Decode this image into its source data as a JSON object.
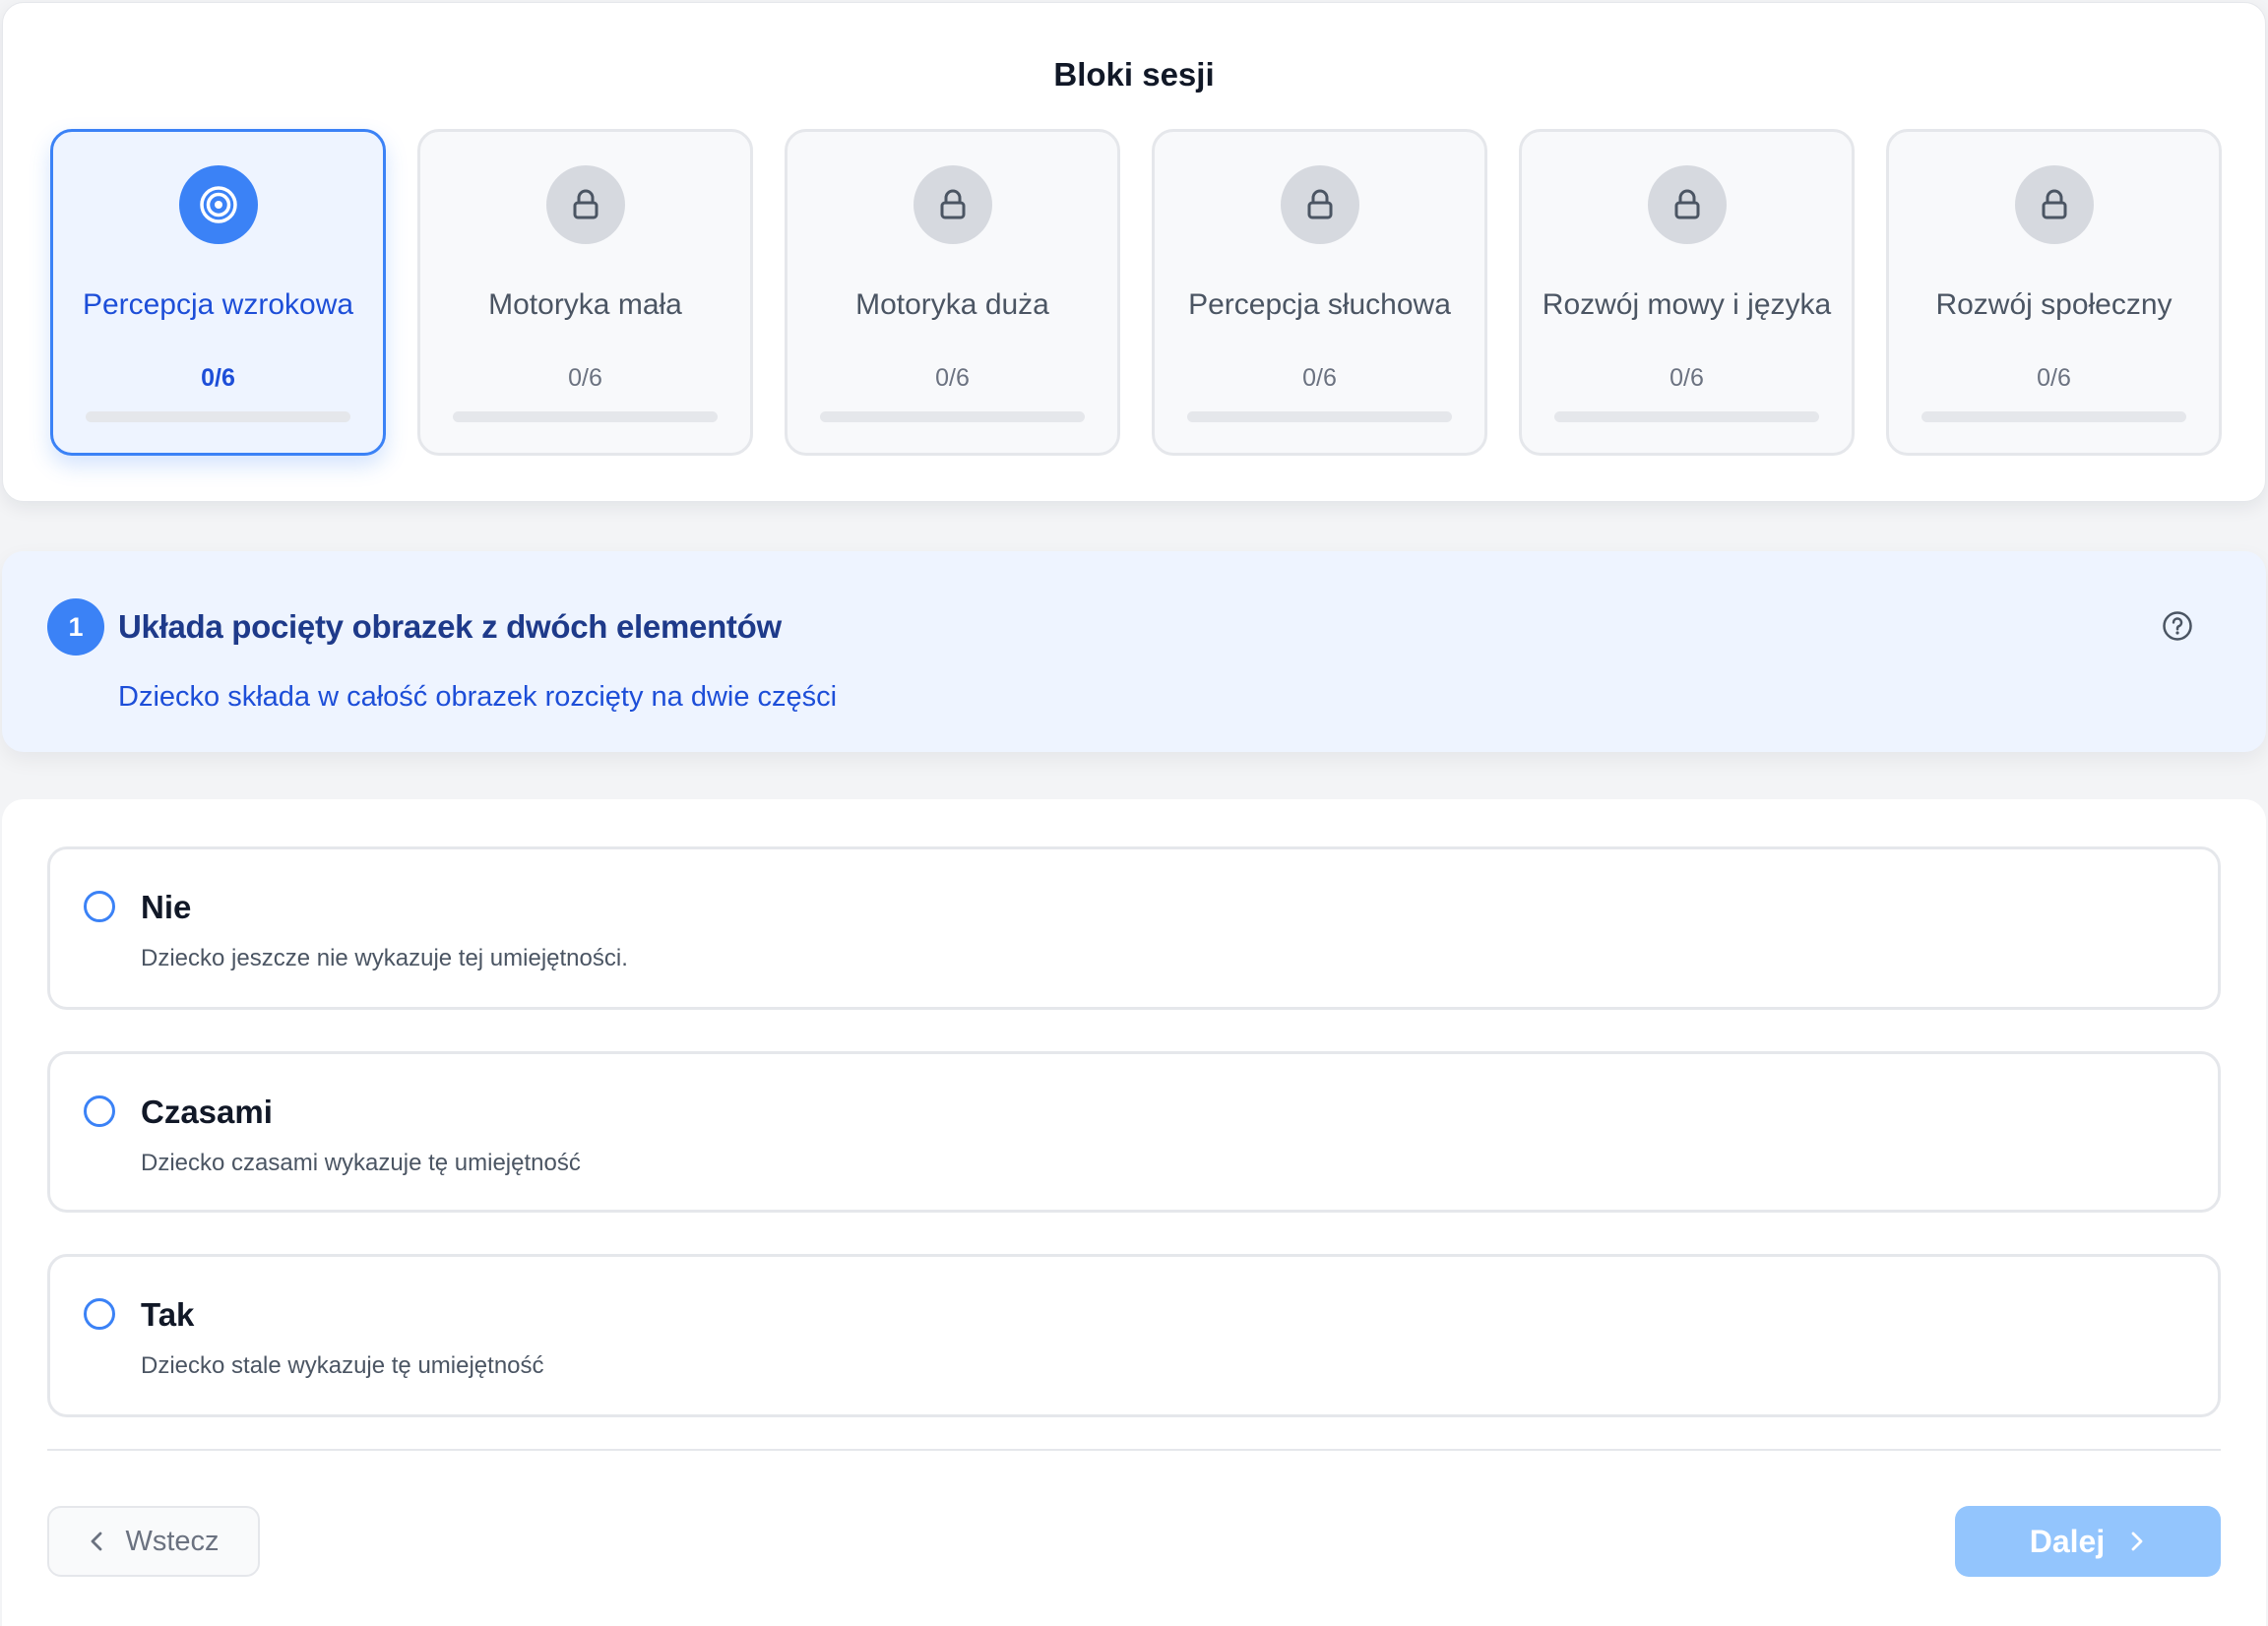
{
  "session_blocks": {
    "title": "Bloki sesji",
    "items": [
      {
        "name": "Percepcja wzrokowa",
        "count": "0/6",
        "progress": 0,
        "state": "active",
        "icon": "target-icon"
      },
      {
        "name": "Motoryka mała",
        "count": "0/6",
        "progress": 0,
        "state": "locked",
        "icon": "lock-icon"
      },
      {
        "name": "Motoryka duża",
        "count": "0/6",
        "progress": 0,
        "state": "locked",
        "icon": "lock-icon"
      },
      {
        "name": "Percepcja słuchowa",
        "count": "0/6",
        "progress": 0,
        "state": "locked",
        "icon": "lock-icon"
      },
      {
        "name": "Rozwój mowy i języka",
        "count": "0/6",
        "progress": 0,
        "state": "locked",
        "icon": "lock-icon"
      },
      {
        "name": "Rozwój społeczny",
        "count": "0/6",
        "progress": 0,
        "state": "locked",
        "icon": "lock-icon"
      }
    ]
  },
  "question": {
    "number": "1",
    "title": "Układa pocięty obrazek z dwóch elementów",
    "description": "Dziecko składa w całość obrazek rozcięty na dwie części",
    "help_icon": "question-circle-icon"
  },
  "options": [
    {
      "label": "Nie",
      "description": "Dziecko jeszcze nie wykazuje tej umiejętności.",
      "selected": false
    },
    {
      "label": "Czasami",
      "description": "Dziecko czasami wykazuje tę umiejętność",
      "selected": false
    },
    {
      "label": "Tak",
      "description": "Dziecko stale wykazuje tę umiejętność",
      "selected": false
    }
  ],
  "navigation": {
    "back_label": "Wstecz",
    "next_label": "Dalej"
  },
  "colors": {
    "accent": "#3b82f6",
    "accent_dark": "#1d4ed8",
    "accent_disabled": "#93c5fd",
    "locked": "#d6d9df"
  }
}
